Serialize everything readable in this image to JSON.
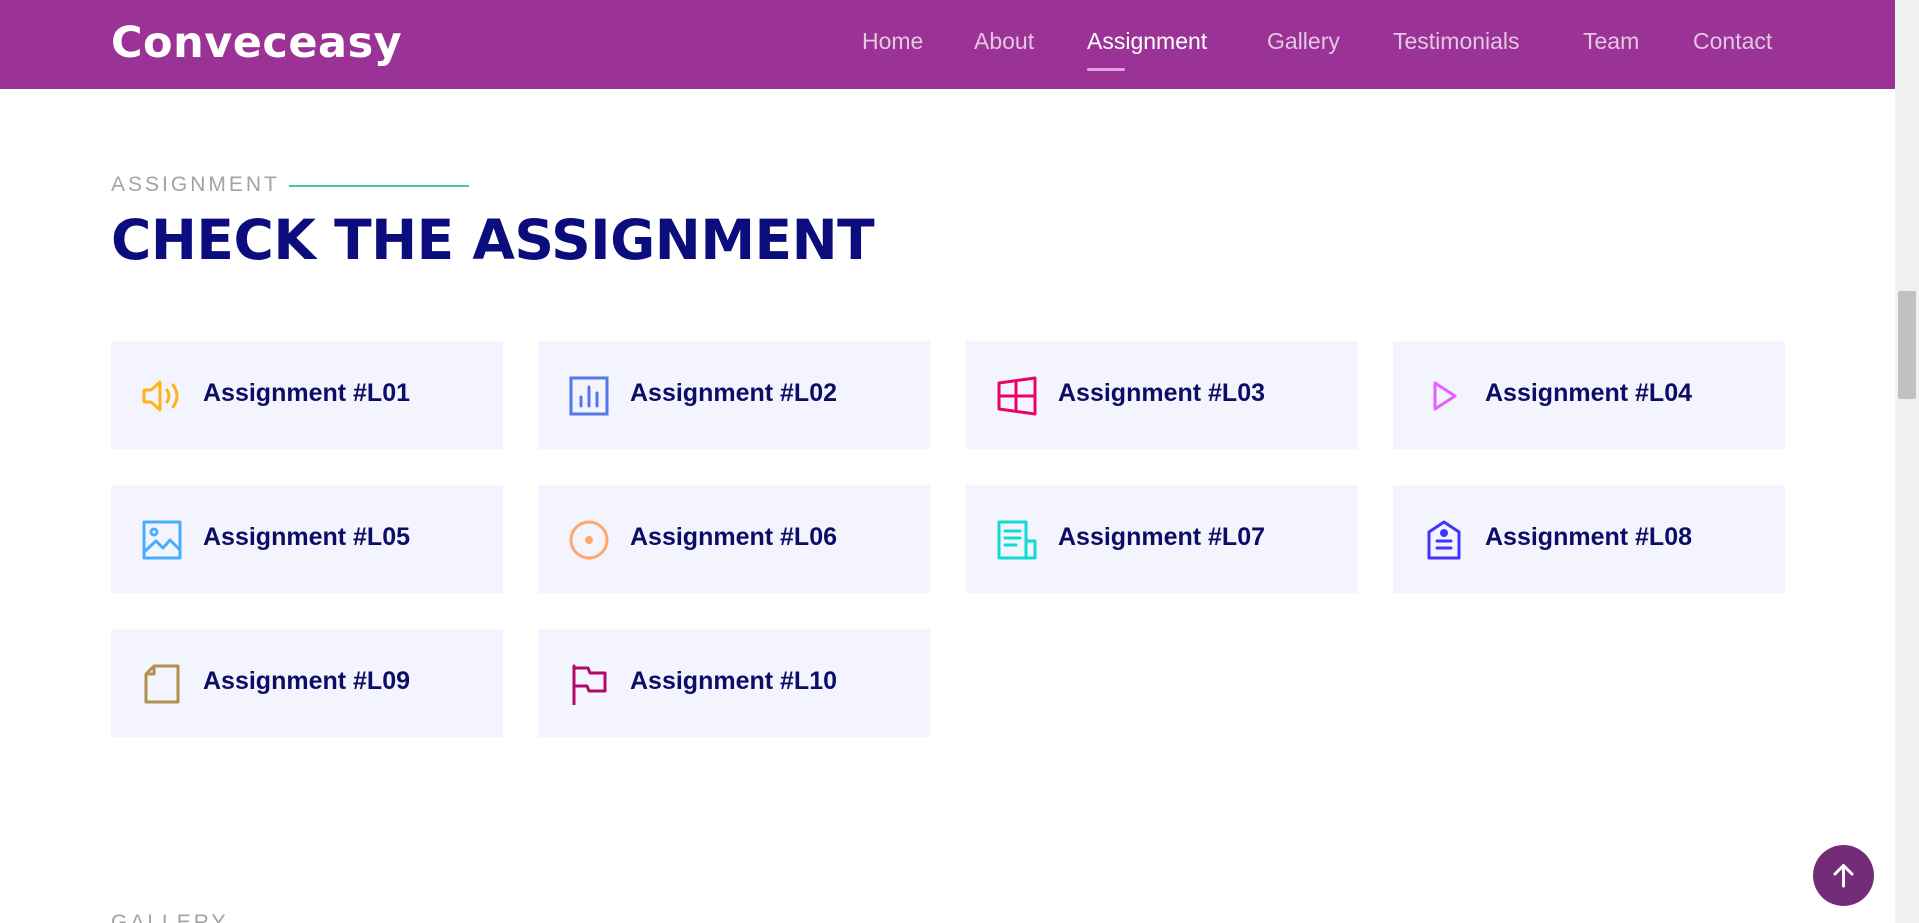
{
  "header": {
    "logo": "Conveceasy",
    "background": "#9b3397",
    "nav": [
      {
        "label": "Home",
        "active": false
      },
      {
        "label": "About",
        "active": false
      },
      {
        "label": "Assignment",
        "active": true
      },
      {
        "label": "Gallery",
        "active": false
      },
      {
        "label": "Testimonials",
        "active": false
      },
      {
        "label": "Team",
        "active": false
      },
      {
        "label": "Contact",
        "active": false
      }
    ]
  },
  "section": {
    "eyebrow": "ASSIGNMENT",
    "title": "CHECK THE ASSIGNMENT",
    "accent": "#47c4ae",
    "title_color": "#0c0d7c"
  },
  "cards": [
    {
      "label": "Assignment #L01",
      "icon": "megaphone-icon",
      "color": "#ffb31a"
    },
    {
      "label": "Assignment #L02",
      "icon": "bar-chart-icon",
      "color": "#5578e8"
    },
    {
      "label": "Assignment #L03",
      "icon": "windows-icon",
      "color": "#e80368"
    },
    {
      "label": "Assignment #L04",
      "icon": "play-icon",
      "color": "#e361ff"
    },
    {
      "label": "Assignment #L05",
      "icon": "image-icon",
      "color": "#47aeff"
    },
    {
      "label": "Assignment #L06",
      "icon": "target-icon",
      "color": "#ffa76e"
    },
    {
      "label": "Assignment #L07",
      "icon": "document-icon",
      "color": "#11dbcf"
    },
    {
      "label": "Assignment #L08",
      "icon": "tag-icon",
      "color": "#4233ff"
    },
    {
      "label": "Assignment #L09",
      "icon": "file-icon",
      "color": "#b2904f"
    },
    {
      "label": "Assignment #L10",
      "icon": "flag-icon",
      "color": "#b20969"
    }
  ],
  "next_section": {
    "eyebrow": "GALLERY"
  },
  "back_to_top": {
    "icon": "arrow-up-icon",
    "color": "#742b78"
  }
}
